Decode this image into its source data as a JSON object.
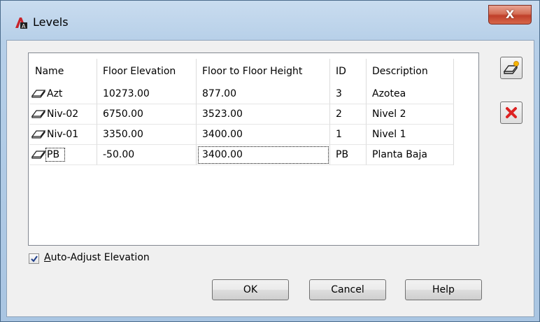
{
  "window": {
    "title": "Levels",
    "close_label": "X"
  },
  "table": {
    "columns": [
      "Name",
      "Floor Elevation",
      "Floor to Floor Height",
      "ID",
      "Description"
    ],
    "rows": [
      {
        "name": "Azt",
        "elevation": "10273.00",
        "height": "877.00",
        "id": "3",
        "description": "Azotea"
      },
      {
        "name": "Niv-02",
        "elevation": "6750.00",
        "height": "3523.00",
        "id": "2",
        "description": "Nivel 2"
      },
      {
        "name": "Niv-01",
        "elevation": "3350.00",
        "height": "3400.00",
        "id": "1",
        "description": "Nivel 1"
      },
      {
        "name": "PB",
        "elevation": "-50.00",
        "height": "3400.00",
        "id": "PB",
        "description": "Planta Baja"
      }
    ]
  },
  "side_buttons": {
    "add_icon": "add-level-icon",
    "delete_icon": "delete-icon"
  },
  "auto_adjust": {
    "label_prefix": "A",
    "label_rest": "uto-Adjust Elevation",
    "checked": true
  },
  "buttons": {
    "ok": "OK",
    "cancel": "Cancel",
    "help": "Help"
  },
  "colors": {
    "title_gradient_top": "#c9dcef",
    "close_red": "#c0402a",
    "delete_red": "#d22"
  }
}
